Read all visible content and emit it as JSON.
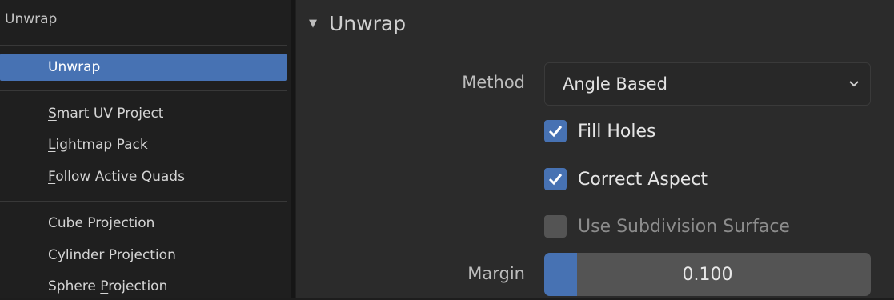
{
  "menu": {
    "title": "Unwrap",
    "items": [
      {
        "label": "Unwrap",
        "accel": "U",
        "rest": "nwrap",
        "selected": true
      },
      {
        "label": "Smart UV Project",
        "accel": "S",
        "rest": "mart UV Project"
      },
      {
        "label": "Lightmap Pack",
        "accel": "L",
        "rest": "ightmap Pack"
      },
      {
        "label": "Follow Active Quads",
        "accel": "F",
        "rest": "ollow Active Quads"
      },
      {
        "label": "Cube Projection",
        "accel": "C",
        "rest": "ube Projection"
      },
      {
        "label": "Cylinder Projection",
        "pre": "Cylinder ",
        "accel": "P",
        "rest": "rojection"
      },
      {
        "label": "Sphere Projection",
        "pre": "Sphere ",
        "accel": "P",
        "rest": "rojection"
      }
    ]
  },
  "panel": {
    "title": "Unwrap",
    "method": {
      "label": "Method",
      "value": "Angle Based"
    },
    "fill_holes": {
      "label": "Fill Holes",
      "checked": true
    },
    "correct_aspect": {
      "label": "Correct Aspect",
      "checked": true
    },
    "use_subdivision": {
      "label": "Use Subdivision Surface",
      "checked": false
    },
    "margin": {
      "label": "Margin",
      "value": "0.100",
      "fraction": 0.1
    }
  },
  "colors": {
    "accent": "#4772b3",
    "panel_bg": "#2b2b2b",
    "menu_bg": "#1f1f1f"
  },
  "icons": [
    "disclosure-triangle-icon",
    "chevron-down-icon",
    "checkmark-icon"
  ]
}
